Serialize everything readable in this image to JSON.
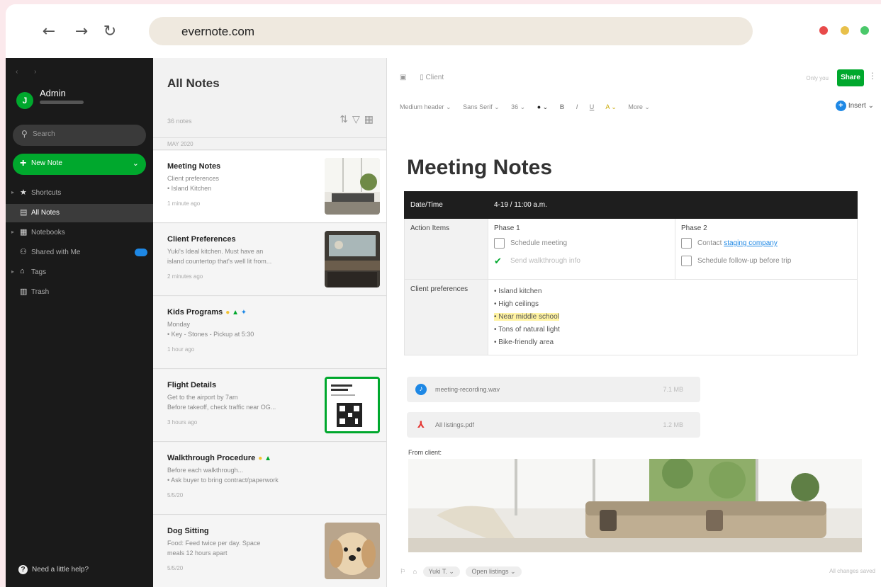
{
  "browser": {
    "back": "←",
    "forward": "→",
    "reload": "↻",
    "url": "evernote.com",
    "window_dots": [
      "#e84a4a",
      "#e8c04a",
      "#4ac86a"
    ]
  },
  "sidebar": {
    "nav_arrows": "‹ ›",
    "avatar_letter": "J",
    "user_name": "Admin",
    "search_label": "Search",
    "new_note_label": "New Note",
    "items": [
      {
        "label": "Shortcuts",
        "icon": "star-icon"
      },
      {
        "label": "All Notes",
        "icon": "notes-icon"
      },
      {
        "label": "Notebooks",
        "icon": "notebook-icon"
      },
      {
        "label": "Shared with Me",
        "icon": "shared-icon"
      },
      {
        "label": "Tags",
        "icon": "tag-icon"
      },
      {
        "label": "Trash",
        "icon": "trash-icon"
      }
    ],
    "help_label": "Need a little help?"
  },
  "notelist": {
    "title": "All Notes",
    "count": "36 notes",
    "group_label": "MAY 2020",
    "notes": [
      {
        "title": "Meeting Notes",
        "line1": "Client preferences",
        "line2": "• Island Kitchen",
        "time": "1 minute ago"
      },
      {
        "title": "Client Preferences",
        "line1": "Yuki's Ideal kitchen. Must have an",
        "line2": "island countertop that's well lit from...",
        "time": "2 minutes ago"
      },
      {
        "title": "Kids Programs",
        "line1": "Monday",
        "line2": "• Key - Stones - Pickup at 5:30",
        "time": "1 hour ago"
      },
      {
        "title": "Flight Details",
        "line1": "Get to the airport by 7am",
        "line2": "Before takeoff, check traffic near OG...",
        "time": "3 hours ago"
      },
      {
        "title": "Walkthrough Procedure",
        "line1": "Before each walkthrough...",
        "line2": "• Ask buyer to bring contract/paperwork",
        "time": "5/5/20"
      },
      {
        "title": "Dog Sitting",
        "line1": "Food: Feed twice per day. Space",
        "line2": "meals 12 hours apart",
        "time": "5/5/20"
      }
    ]
  },
  "editor": {
    "top_label": "Client",
    "only_you": "Only you",
    "share_label": "Share",
    "toolbar": {
      "style": "Medium header ⌄",
      "font": "Sans Serif ⌄",
      "size": "36 ⌄",
      "color": "● ⌄",
      "bold": "B",
      "italic": "I",
      "underline": "U",
      "highlight": "A ⌄",
      "more": "More ⌄"
    },
    "insert_label": "Insert ⌄",
    "title": "Meeting Notes",
    "table": {
      "datetime_label": "Date/Time",
      "datetime_value": "4-19 / 11:00 a.m.",
      "action_label": "Action Items",
      "phase1_title": "Phase 1",
      "phase1_items": [
        "Schedule meeting",
        "Send walkthrough info"
      ],
      "phase2_title": "Phase 2",
      "phase2_item1_prefix": "Contact",
      "phase2_item1_link": "staging company",
      "phase2_item2": "Schedule follow-up before trip",
      "prefs_label": "Client preferences",
      "prefs": [
        "• Island kitchen",
        "• High ceilings",
        "• Near middle school",
        "• Tons of natural light",
        "• Bike-friendly area"
      ]
    },
    "attachments": [
      {
        "name": "meeting-recording.wav",
        "size": "7.1 MB"
      },
      {
        "name": "All listings.pdf",
        "size": "1.2 MB"
      }
    ],
    "from_client": "From client:",
    "bottom": {
      "tag1": "Yuki T. ⌄",
      "tag2": "Open listings ⌄",
      "saved": "All changes saved"
    }
  }
}
